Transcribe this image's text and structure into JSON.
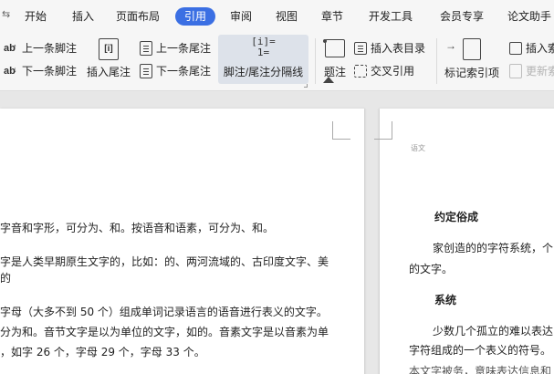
{
  "menu": {
    "chevron": "⇆",
    "tabs": [
      {
        "label": "开始"
      },
      {
        "label": "插入"
      },
      {
        "label": "页面布局"
      },
      {
        "label": "引用",
        "active": true
      },
      {
        "label": "审阅"
      },
      {
        "label": "视图"
      },
      {
        "label": "章节"
      },
      {
        "label": "开发工具"
      },
      {
        "label": "会员专享"
      },
      {
        "label": "论文助手"
      }
    ]
  },
  "ribbon": {
    "prev_footnote": "上一条脚注",
    "next_footnote": "下一条脚注",
    "insert_endnote": "插入尾注",
    "prev_endnote": "上一条尾注",
    "next_endnote": "下一条尾注",
    "separator_line": "脚注/尾注分隔线",
    "separator_icon_top": "[i]=",
    "separator_icon_bottom": "1=",
    "caption": "题注",
    "insert_table_of_figures": "插入表目录",
    "cross_reference": "交叉引用",
    "mark_index_entry": "标记索引项",
    "insert_index": "插入索",
    "update_index": "更新索",
    "endnote_icon": "[i]",
    "footnote_icon_text": "ab"
  },
  "document": {
    "left_lines": [
      "字音和字形，可分为、和。按语音和语素，可分为、和。",
      "字是人类早期原生文字的，比如：的、两河流域的、古印度文字、美",
      "的",
      "字母（大多不到 50 个）组成单词记录语言的语音进行表义的文字。",
      "分为和。音节文字是以为单位的文字，如的。音素文字是以音素为单",
      "，如字 26 个，字母 29 个，字母 33 个。"
    ],
    "right_header_text": "语文",
    "right_heading_1": "约定俗成",
    "right_para_1a": "家创造的的字符系统，个",
    "right_para_1b": "的文字。",
    "right_heading_2": "系统",
    "right_para_2a": "少数几个孤立的难以表达",
    "right_para_2b": "字符组成的一个表义的符号。",
    "right_para_2c": "本文字被务，意味表达信息和"
  }
}
